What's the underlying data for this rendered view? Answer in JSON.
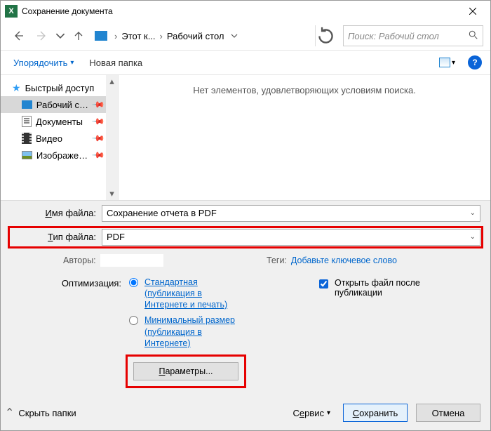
{
  "window": {
    "title": "Сохранение документа"
  },
  "nav": {
    "bc1": "Этот к...",
    "bc2": "Рабочий стол",
    "search_placeholder": "Поиск: Рабочий стол"
  },
  "toolbar": {
    "organize": "Упорядочить",
    "new_folder": "Новая папка"
  },
  "sidebar": {
    "quick": "Быстрый доступ",
    "desktop": "Рабочий стол",
    "documents": "Документы",
    "video": "Видео",
    "images": "Изображения"
  },
  "filearea": {
    "empty_msg": "Нет элементов, удовлетворяющих условиям поиска."
  },
  "filename": {
    "label": "Имя файла:",
    "value": "Сохранение отчета в PDF"
  },
  "filetype": {
    "label": "Тип файла:",
    "value": "PDF"
  },
  "meta": {
    "authors_label": "Авторы:",
    "authors_value": "",
    "tags_label": "Теги:",
    "tags_value": "Добавьте ключевое слово"
  },
  "optimize": {
    "label": "Оптимизация:",
    "std": "Стандартная (публикация в Интернете и печать)",
    "min": "Минимальный размер (публикация в Интернете)",
    "open_after": "Открыть файл после публикации",
    "params": "Параметры..."
  },
  "footer": {
    "hide_folders": "Скрыть папки",
    "service": "Сервис",
    "save": "Сохранить",
    "cancel": "Отмена"
  }
}
